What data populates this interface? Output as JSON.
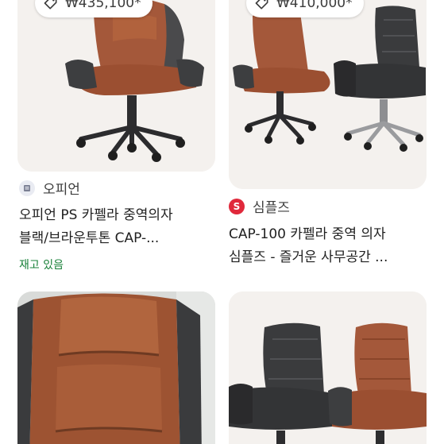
{
  "results": [
    {
      "price": "₩435,100*",
      "source": "오피언",
      "title_line1": "오피언 PS 카펠라 중역의자",
      "title_line2": "블랙/브라운투톤 CAP-...",
      "stock": "재고 있음",
      "tag_icon": "tag-icon",
      "favicon_icon": "store-favicon-icon"
    },
    {
      "price": "₩410,000*",
      "source": "심플즈",
      "title_line1": "CAP-100 카펠라 중역 의자",
      "title_line2": "심플즈 - 즐거운 사무공간 ...",
      "tag_icon": "tag-icon",
      "favicon_icon": "simples-logo-icon",
      "favicon_letter": "S",
      "favicon_color": "#e0293b"
    },
    {
      "image_icon": "brown-chair-closeup-image"
    },
    {
      "image_icon": "dark-and-brown-chairs-image"
    }
  ],
  "colors": {
    "stock_green": "#188038",
    "chair_brown": "#a55a36",
    "chair_dark": "#3a3b3d"
  }
}
